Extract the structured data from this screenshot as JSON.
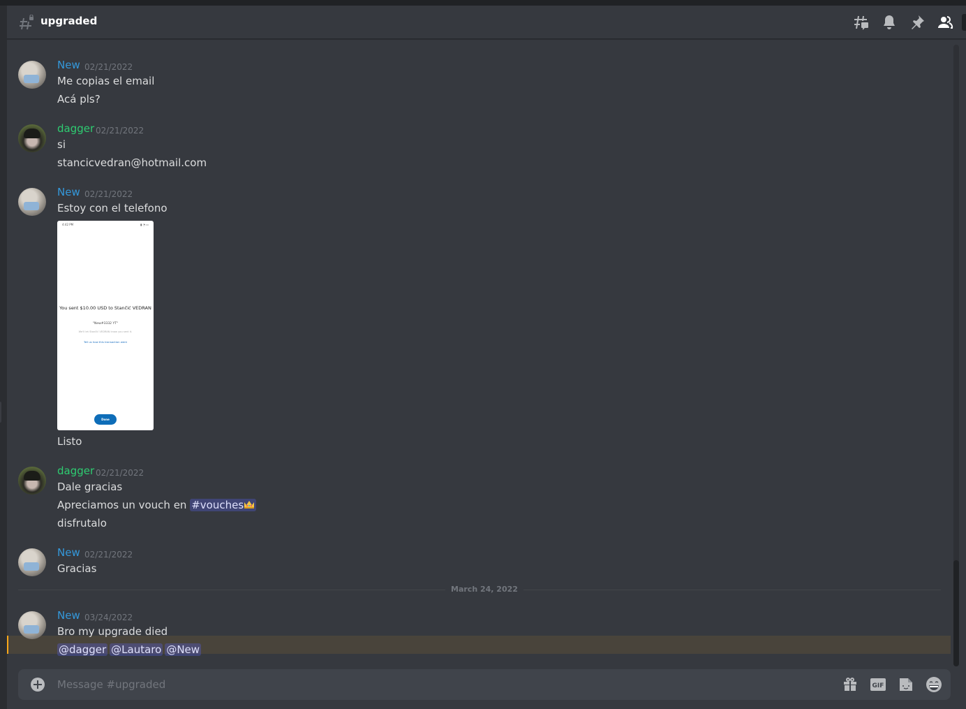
{
  "header": {
    "channel_name": "upgraded",
    "icons": [
      "locked-hashtag-icon",
      "threads-icon",
      "notification-bell-icon",
      "pinned-messages-icon",
      "member-list-icon"
    ]
  },
  "colors": {
    "username_new": "#3498db",
    "username_dagger": "#2ecc71",
    "mention_highlight": "#faa81a",
    "background": "#36393f"
  },
  "messages": [
    {
      "author": "New",
      "timestamp": "02/21/2022",
      "lines": [
        "Me copias el email",
        "Acá pls?"
      ]
    },
    {
      "author": "dagger",
      "timestamp": "02/21/2022",
      "lines": [
        "si",
        "stancicvedran@hotmail.com"
      ]
    },
    {
      "author": "New",
      "timestamp": "02/21/2022",
      "lines": [
        "Estoy con el telefono",
        "Listo"
      ],
      "attachment": {
        "status_left": "4:42 PM",
        "title": "You sent $10.00 USD to Stančić VEDRAN",
        "note": "\"New#3332 YT\"",
        "subtext": "We'll let Stančić VEDRAN know you sent it.",
        "link": "Tell us how this transaction went",
        "button": "Done"
      }
    },
    {
      "author": "dagger",
      "timestamp": "02/21/2022",
      "lines": [
        "Dale gracias",
        "Apreciamos un vouch en",
        "disfrutalo"
      ],
      "channel_mention": "#vouches",
      "channel_mention_emoji": "crown-icon"
    },
    {
      "author": "New",
      "timestamp": "02/21/2022",
      "lines": [
        "Gracias"
      ]
    },
    {
      "author": "New",
      "timestamp": "03/24/2022",
      "lines": [
        "Bro my upgrade died"
      ],
      "mentions": [
        "@dagger",
        "@Lautaro",
        "@New"
      ]
    }
  ],
  "date_divider": "March 24, 2022",
  "composer": {
    "placeholder": "Message #upgraded",
    "icons": [
      "add-attachment-icon",
      "gift-icon",
      "gif-icon",
      "sticker-icon",
      "emoji-icon"
    ],
    "gif_label": "GIF"
  }
}
